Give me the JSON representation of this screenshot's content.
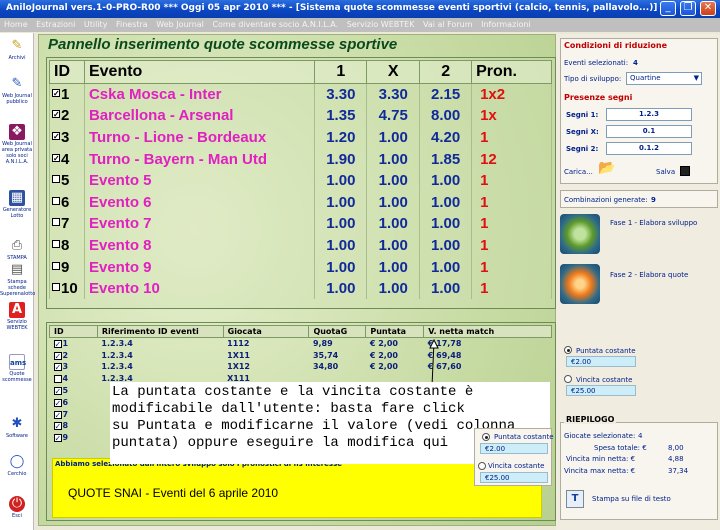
{
  "window": {
    "title": "AniloJournal vers.1-0-PRO-R00  ***  Oggi 05 apr 2010  ***  - [Sistema quote scommesse eventi sportivi (calcio, tennis, pallavolo...)]",
    "minimize": "_",
    "restore": "❐",
    "close": "✕"
  },
  "menu": [
    "Home",
    "Estrazioni",
    "Utility",
    "Finestra",
    "Web Journal",
    "Come diventare socio A.N.I.L.A.",
    "Servizio WEBTEK",
    "Vai al Forum",
    "Informazioni"
  ],
  "sidebar": [
    {
      "label": "Archivi",
      "icon": "pencil-icon",
      "glyph": "✎"
    },
    {
      "label": "Web Journal pubblico",
      "icon": "notebook-icon",
      "glyph": "✎"
    },
    {
      "label": "Web Journal area privata solo soci A.N.I.L.A.",
      "icon": "book-icon",
      "glyph": "❖"
    },
    {
      "label": "Generatore Lotto",
      "icon": "calculator-icon",
      "glyph": "▦"
    },
    {
      "label": "STAMPA",
      "icon": "printer-icon",
      "glyph": "⎙"
    },
    {
      "label": "Stampa schede Superenalotto",
      "icon": "document-icon",
      "glyph": "▤"
    },
    {
      "label": "Servizio WEBTEK",
      "icon": "webtek-logo-icon",
      "glyph": "A"
    },
    {
      "label": "Quote scommesse",
      "icon": "ams-logo-icon",
      "glyph": "ams"
    },
    {
      "label": "Software",
      "icon": "software-icon",
      "glyph": "✱"
    },
    {
      "label": "Cerchio",
      "icon": "circle-icon",
      "glyph": "◯"
    },
    {
      "label": "Esci",
      "icon": "exit-icon",
      "glyph": "⏻"
    }
  ],
  "panel_title": "Pannello inserimento quote scommesse sportive",
  "odds_table": {
    "headers": [
      "ID",
      "Evento",
      "1",
      "X",
      "2",
      "Pron."
    ],
    "rows": [
      {
        "id": "1",
        "checked": true,
        "event": "Cska Mosca - Inter",
        "o1": "3.30",
        "ox": "3.30",
        "o2": "2.15",
        "pron": "1x2"
      },
      {
        "id": "2",
        "checked": true,
        "event": "Barcellona - Arsenal",
        "o1": "1.35",
        "ox": "4.75",
        "o2": "8.00",
        "pron": "1x"
      },
      {
        "id": "3",
        "checked": true,
        "event": "Turno - Lione - Bordeaux",
        "o1": "1.20",
        "ox": "1.00",
        "o2": "4.20",
        "pron": "1"
      },
      {
        "id": "4",
        "checked": true,
        "event": "Turno - Bayern - Man Utd",
        "o1": "1.90",
        "ox": "1.00",
        "o2": "1.85",
        "pron": "12"
      },
      {
        "id": "5",
        "checked": false,
        "event": "Evento 5",
        "o1": "1.00",
        "ox": "1.00",
        "o2": "1.00",
        "pron": "1"
      },
      {
        "id": "6",
        "checked": false,
        "event": "Evento 6",
        "o1": "1.00",
        "ox": "1.00",
        "o2": "1.00",
        "pron": "1"
      },
      {
        "id": "7",
        "checked": false,
        "event": "Evento 7",
        "o1": "1.00",
        "ox": "1.00",
        "o2": "1.00",
        "pron": "1"
      },
      {
        "id": "8",
        "checked": false,
        "event": "Evento 8",
        "o1": "1.00",
        "ox": "1.00",
        "o2": "1.00",
        "pron": "1"
      },
      {
        "id": "9",
        "checked": false,
        "event": "Evento 9",
        "o1": "1.00",
        "ox": "1.00",
        "o2": "1.00",
        "pron": "1"
      },
      {
        "id": "10",
        "checked": false,
        "event": "Evento 10",
        "o1": "1.00",
        "ox": "1.00",
        "o2": "1.00",
        "pron": "1"
      }
    ]
  },
  "bets_table": {
    "headers": [
      "ID",
      "Riferimento ID eventi",
      "Giocata",
      "QuotaG",
      "Puntata",
      "V. netta match"
    ],
    "rows": [
      {
        "id": "1",
        "checked": true,
        "ref": "1.2.3.4",
        "giocata": "1112",
        "quota": "9,89",
        "puntata": "€ 2,00",
        "vnetta": "€ 17,78"
      },
      {
        "id": "2",
        "checked": true,
        "ref": "1.2.3.4",
        "giocata": "1X11",
        "quota": "35,74",
        "puntata": "€ 2,00",
        "vnetta": "€ 69,48"
      },
      {
        "id": "3",
        "checked": true,
        "ref": "1.2.3.4",
        "giocata": "1X12",
        "quota": "34,80",
        "puntata": "€ 2,00",
        "vnetta": "€ 67,60"
      },
      {
        "id": "4",
        "checked": false,
        "ref": "1.2.3.4",
        "giocata": "X111",
        "quota": "",
        "puntata": "",
        "vnetta": ""
      },
      {
        "id": "5",
        "checked": true,
        "ref": "",
        "giocata": "",
        "quota": "",
        "puntata": "",
        "vnetta": ""
      },
      {
        "id": "6",
        "checked": true,
        "ref": "",
        "giocata": "",
        "quota": "",
        "puntata": "",
        "vnetta": ""
      },
      {
        "id": "7",
        "checked": true,
        "ref": "",
        "giocata": "",
        "quota": "",
        "puntata": "",
        "vnetta": ""
      },
      {
        "id": "8",
        "checked": true,
        "ref": "",
        "giocata": "",
        "quota": "",
        "puntata": "",
        "vnetta": ""
      },
      {
        "id": "9",
        "checked": true,
        "ref": "",
        "giocata": "",
        "quota": "",
        "puntata": "",
        "vnetta": ""
      }
    ]
  },
  "info_text": "Abbiamo selezionato dall'intero sviluppo solo i pronostici di ns interesse",
  "snai_text": "QUOTE SNAI - Eventi del 6 aprile 2010",
  "overlay_lines": [
    "La puntata costante e la vincita costante è",
    "modificabile dall'utente: basta fare click",
    "su Puntata e modificarne il valore (vedi colonna",
    "puntata) oppure eseguire la modifica qui"
  ],
  "right": {
    "reduction_title": "Condizioni di riduzione",
    "eventi_label": "Eventi selezionati:",
    "eventi_value": "4",
    "sviluppo_label": "Tipo di sviluppo:",
    "sviluppo_value": "Quartine",
    "segni_title": "Presenze segni",
    "segni": [
      {
        "label": "Segni 1:",
        "value": "1.2.3"
      },
      {
        "label": "Segni X:",
        "value": "0.1"
      },
      {
        "label": "Segni 2:",
        "value": "0.1.2"
      }
    ],
    "carica": "Carica...",
    "salva": "Salva",
    "comb_label": "Combinazioni generate:",
    "comb_value": "9",
    "fase1": "Fase 1 - Elabora sviluppo",
    "fase2": "Fase 2 - Elabora quote",
    "puntata_costante": "Puntata costante",
    "puntata_value": "2.00",
    "vincita_costante": "Vincita costante",
    "vincita_value": "25.00",
    "riepilogo_title": "RIEPILOGO",
    "riepilogo": [
      {
        "label": "Giocate selezionate:",
        "value": "4"
      },
      {
        "label": "Spesa totale: €",
        "value": "8,00"
      },
      {
        "label": "Vincita min netta: €",
        "value": "4,88"
      },
      {
        "label": "Vincita max netta: €",
        "value": "37,34"
      }
    ],
    "stampa": "Stampa su file di testo"
  },
  "popup": {
    "puntata_costante": "Puntata costante",
    "puntata_value": "2.00",
    "vincita_costante": "Vincita costante",
    "vincita_value": "25.00"
  }
}
